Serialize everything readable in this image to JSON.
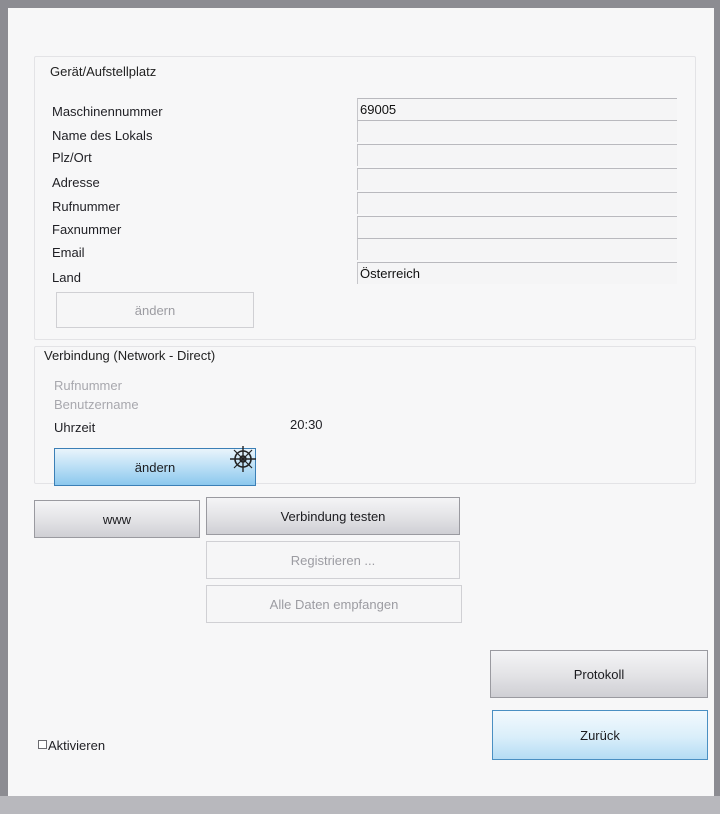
{
  "device_section": {
    "title": "Gerät/Aufstellplatz",
    "fields": [
      {
        "label": "Maschinennummer",
        "value": "69005"
      },
      {
        "label": "Name des Lokals",
        "value": ""
      },
      {
        "label": "Plz/Ort",
        "value": ""
      },
      {
        "label": "Adresse",
        "value": ""
      },
      {
        "label": "Rufnummer",
        "value": ""
      },
      {
        "label": "Faxnummer",
        "value": ""
      },
      {
        "label": "Email",
        "value": ""
      },
      {
        "label": "Land",
        "value": "Österreich"
      }
    ],
    "change_label": "ändern"
  },
  "connection_section": {
    "title": "Verbindung (Network - Direct)",
    "rufnummer_label": "Rufnummer",
    "benutzername_label": "Benutzername",
    "uhrzeit_label": "Uhrzeit",
    "uhrzeit_value": "20:30",
    "change_label": "ändern"
  },
  "buttons": {
    "www": "www",
    "test_connection": "Verbindung testen",
    "register": "Registrieren ...",
    "receive_all": "Alle Daten empfangen",
    "protocol": "Protokoll",
    "back": "Zurück"
  },
  "activate": {
    "label": "Aktivieren",
    "checked": false
  },
  "icons": {
    "busy_cursor": "crosshair-wheel-icon"
  }
}
